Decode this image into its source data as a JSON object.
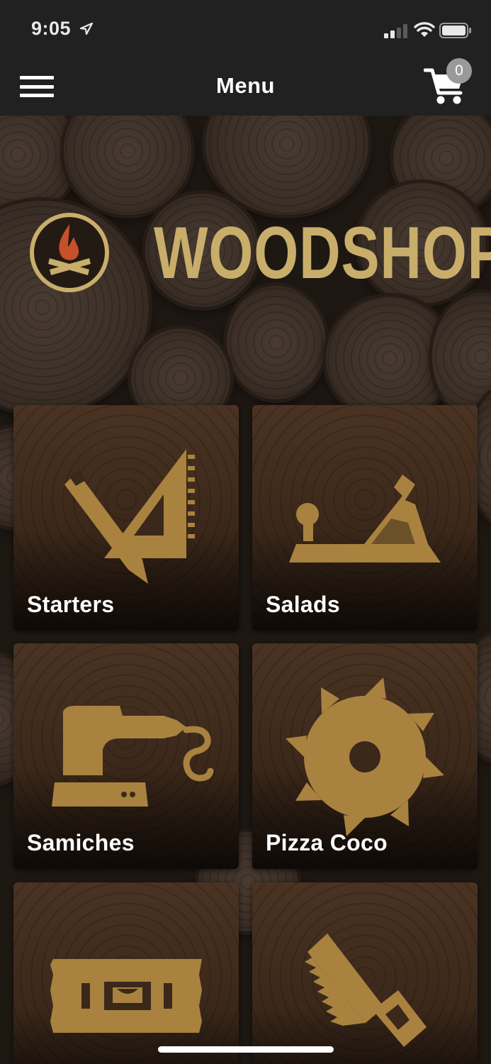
{
  "status_bar": {
    "time": "9:05",
    "icons": [
      "location-arrow-icon",
      "cellular-signal-icon",
      "wifi-icon",
      "battery-icon"
    ]
  },
  "nav": {
    "title": "Menu",
    "menu_icon": "hamburger-menu-icon",
    "cart_icon": "shopping-cart-icon",
    "cart_count": "0"
  },
  "hero": {
    "logo_text": "WOODSHOP",
    "logo_icon": "campfire-emblem-icon"
  },
  "categories": [
    {
      "label": "Starters",
      "icon": "carpenter-square-pencil-icon"
    },
    {
      "label": "Salads",
      "icon": "wood-plane-icon"
    },
    {
      "label": "Samiches",
      "icon": "orbital-sander-icon"
    },
    {
      "label": "Pizza Coco",
      "icon": "circular-saw-blade-icon"
    },
    {
      "label": "",
      "icon": "spirit-level-icon"
    },
    {
      "label": "",
      "icon": "hand-saw-icon"
    }
  ],
  "colors": {
    "bar_background": "#222121",
    "accent_gold": "#c9ad6b",
    "icon_gold": "#a9823f",
    "flame_orange": "#c6502a",
    "badge_gray": "#9a9a9a"
  }
}
